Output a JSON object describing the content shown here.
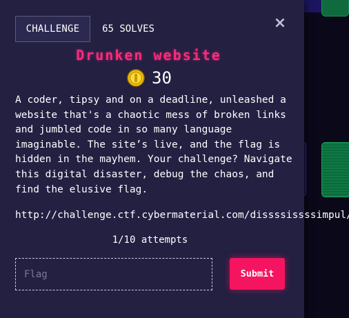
{
  "tabs": {
    "challenge_label": "CHALLENGE",
    "solves_label": "65 SOLVES"
  },
  "close_glyph": "×",
  "challenge": {
    "title": "Drunken website",
    "points": "30",
    "description": "A coder, tipsy and on a deadline, unleashed a website that's a chaotic mess of broken links and jumbled code in so many language imaginable. The site’s live, and the flag is hidden in the mayhem. Your challenge? Navigate this digital disaster, debug the chaos, and find the elusive flag.",
    "link": "http://challenge.ctf.cybermaterial.com/dissssissssimpul/"
  },
  "form": {
    "attempts": "1/10 attempts",
    "flag_placeholder": "Flag",
    "submit_label": "Submit"
  },
  "colors": {
    "modal_bg": "#232042",
    "title": "#ff2a7a",
    "submit_bg": "#f5145f",
    "coin": "#f4c20d"
  },
  "icons": {
    "points": "coin-icon",
    "close": "close-icon"
  }
}
